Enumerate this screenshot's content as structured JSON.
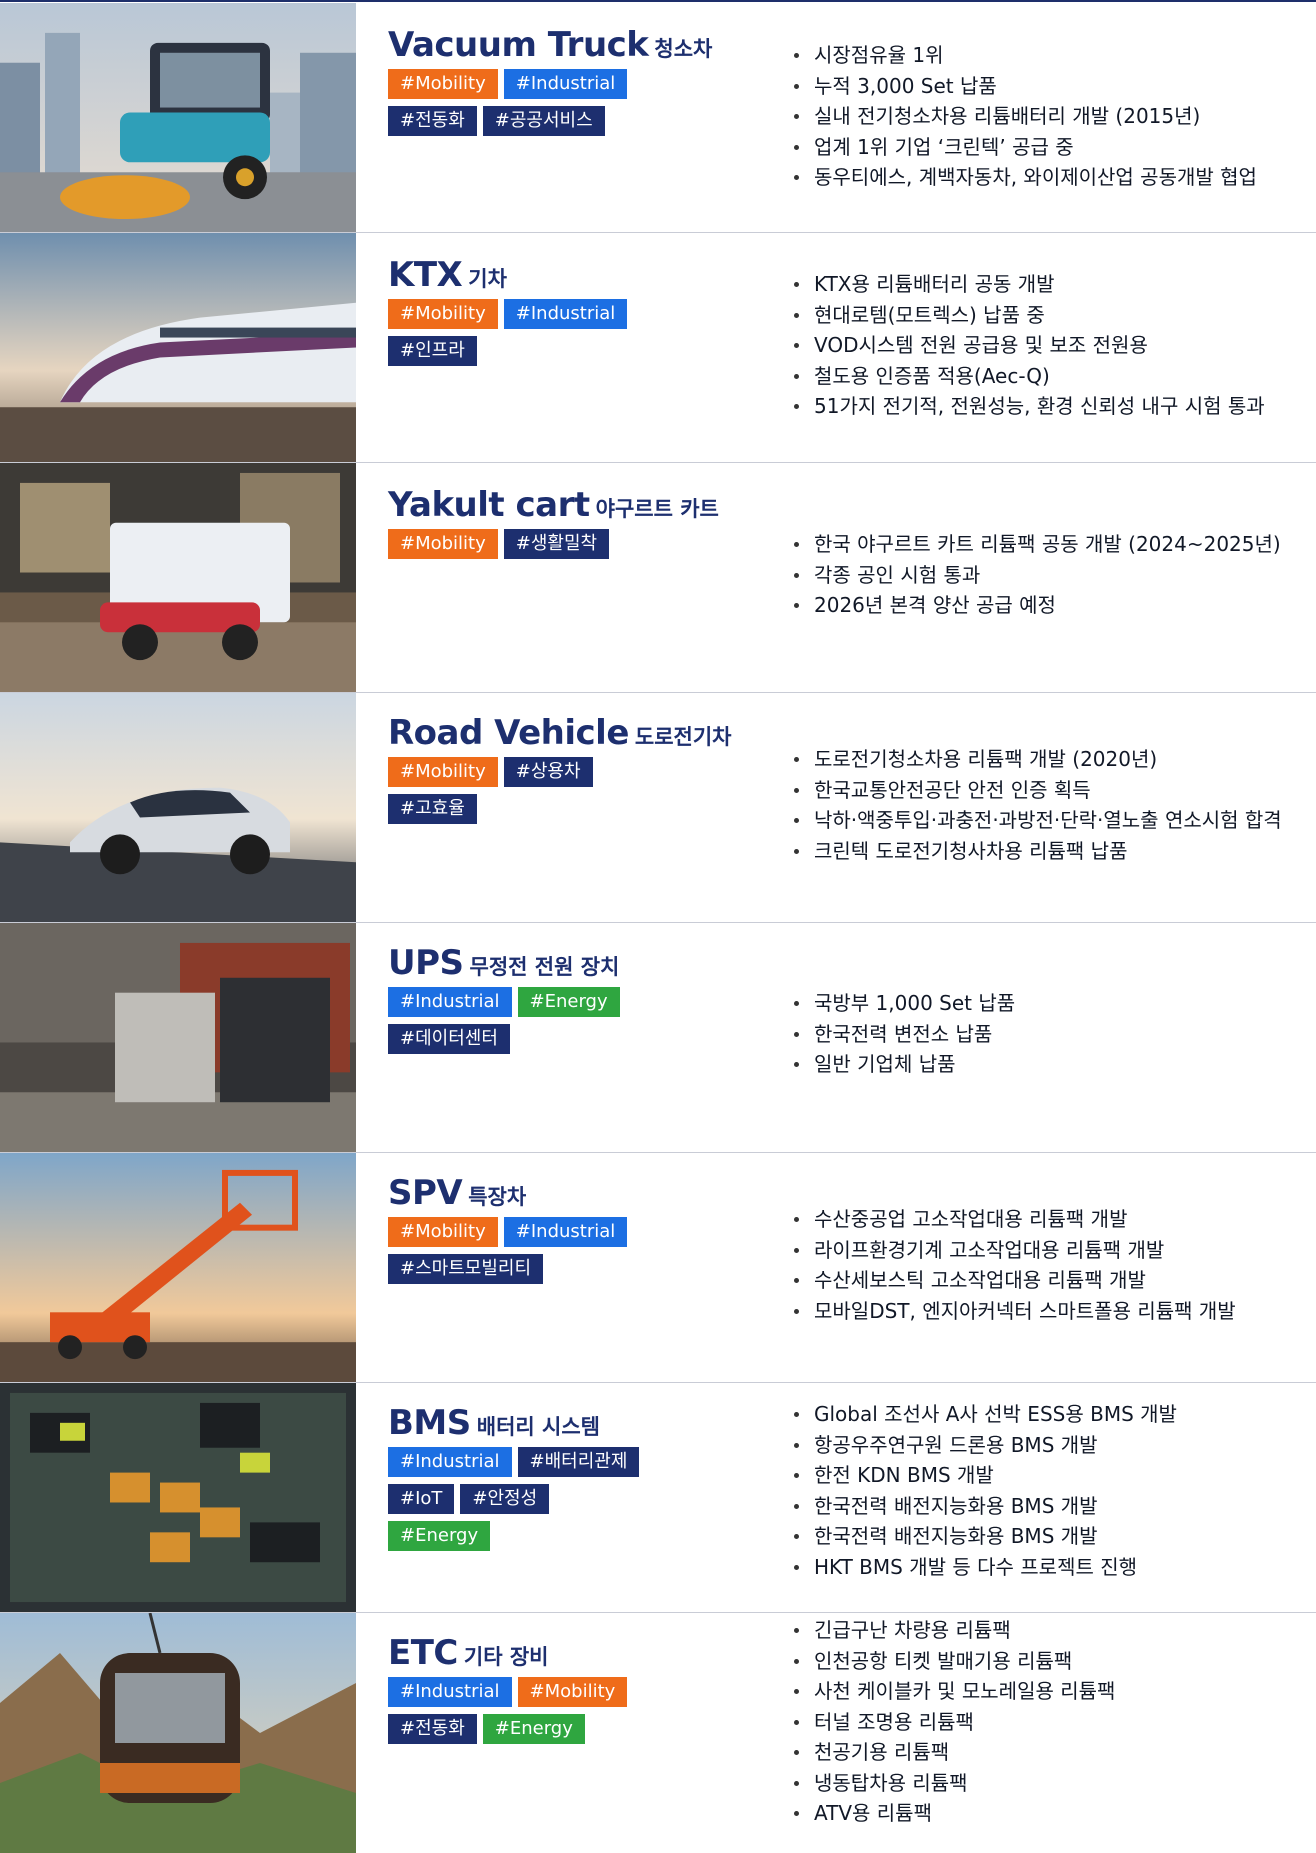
{
  "rows": [
    {
      "image": "vacuum-truck-photo",
      "title_en": "Vacuum Truck",
      "title_ko": "청소차",
      "tags": [
        {
          "label": "#Mobility",
          "kind": "mobility"
        },
        {
          "label": "#Industrial",
          "kind": "industrial"
        },
        {
          "label": "#전동화",
          "kind": "service"
        },
        {
          "label": "#공공서비스",
          "kind": "service"
        }
      ],
      "bullets": [
        "시장점유율 1위",
        "누적 3,000 Set 납품",
        "실내 전기청소차용 리튬배터리 개발 (2015년)",
        "업계 1위 기업 ‘크린텍’ 공급 중",
        "동우티에스, 계백자동차, 와이제이산업 공동개발 협업"
      ]
    },
    {
      "image": "ktx-train-photo",
      "title_en": "KTX",
      "title_ko": "기차",
      "tags": [
        {
          "label": "#Mobility",
          "kind": "mobility"
        },
        {
          "label": "#Industrial",
          "kind": "industrial"
        },
        {
          "label": "#인프라",
          "kind": "service"
        }
      ],
      "bullets": [
        "KTX용 리튬배터리 공동 개발",
        "현대로템(모트렉스) 납품 중",
        "VOD시스템 전원 공급용 및 보조 전원용",
        "철도용 인증품 적용(Aec-Q)",
        "51가지 전기적, 전원성능, 환경 신뢰성 내구 시험 통과"
      ]
    },
    {
      "image": "yakult-cart-photo",
      "title_en": "Yakult cart",
      "title_ko": "야구르트 카트",
      "tags": [
        {
          "label": "#Mobility",
          "kind": "mobility"
        },
        {
          "label": "#생활밀착",
          "kind": "service"
        }
      ],
      "bullets": [
        "한국 야구르트 카트 리튬팩 공동 개발 (2024~2025년)",
        "각종 공인 시험 통과",
        "2026년 본격 양산 공급 예정"
      ]
    },
    {
      "image": "road-vehicle-photo",
      "title_en": "Road Vehicle",
      "title_ko": "도로전기차",
      "tags": [
        {
          "label": "#Mobility",
          "kind": "mobility"
        },
        {
          "label": "#상용차",
          "kind": "service"
        },
        {
          "label": "#고효율",
          "kind": "service"
        }
      ],
      "bullets": [
        "도로전기청소차용 리튬팩 개발 (2020년)",
        "한국교통안전공단 안전 인증 획득",
        "낙하·액중투입·과충전·과방전·단락·열노출 연소시험  합격",
        "크린텍 도로전기청사차용 리튬팩 납품"
      ]
    },
    {
      "image": "ups-unit-photo",
      "title_en": "UPS",
      "title_ko": "무정전 전원 장치",
      "tags": [
        {
          "label": "#Industrial",
          "kind": "industrial"
        },
        {
          "label": "#Energy",
          "kind": "energy"
        },
        {
          "label": "#데이터센터",
          "kind": "service"
        }
      ],
      "bullets": [
        "국방부 1,000 Set 납품",
        "한국전력 변전소 납품",
        "일반 기업체 납품"
      ]
    },
    {
      "image": "spv-lift-photo",
      "title_en": "SPV",
      "title_ko": "특장차",
      "tags": [
        {
          "label": "#Mobility",
          "kind": "mobility"
        },
        {
          "label": "#Industrial",
          "kind": "industrial"
        },
        {
          "label": "#스마트모빌리티",
          "kind": "service"
        }
      ],
      "bullets": [
        "수산중공업 고소작업대용 리튬팩 개발",
        "라이프환경기계 고소작업대용 리튬팩 개발",
        "수산세보스틱 고소작업대용 리튬팩 개발",
        "모바일DST, 엔지아커넥터 스마트폴용 리튬팩 개발"
      ]
    },
    {
      "image": "bms-board-photo",
      "title_en": "BMS",
      "title_ko": "배터리 시스템",
      "tags": [
        {
          "label": "#Industrial",
          "kind": "industrial"
        },
        {
          "label": "#배터리관제",
          "kind": "service"
        },
        {
          "label": "#IoT",
          "kind": "service"
        },
        {
          "label": "#안정성",
          "kind": "service"
        },
        {
          "label": "#Energy",
          "kind": "energy"
        }
      ],
      "bullets": [
        "Global 조선사 A사 선박 ESS용 BMS 개발",
        "항공우주연구원 드론용 BMS 개발",
        "한전 KDN BMS 개발",
        "한국전력 배전지능화용 BMS 개발",
        "한국전력 배전지능화용 BMS 개발",
        "HKT BMS 개발 등 다수 프로젝트 진행"
      ]
    },
    {
      "image": "cable-car-photo",
      "title_en": "ETC",
      "title_ko": "기타 장비",
      "tags": [
        {
          "label": "#Industrial",
          "kind": "industrial"
        },
        {
          "label": "#Mobility",
          "kind": "mobility"
        },
        {
          "label": "#전동화",
          "kind": "service"
        },
        {
          "label": "#Energy",
          "kind": "energy"
        }
      ],
      "bullets": [
        "긴급구난 차량용 리튬팩",
        "인천공항 티켓 발매기용 리튬팩",
        "사천 케이블카 및 모노레일용 리튬팩",
        "터널 조명용 리튬팩",
        "천공기용 리튬팩",
        "냉동탑차용 리튬팩",
        "ATV용 리튬팩"
      ]
    }
  ]
}
